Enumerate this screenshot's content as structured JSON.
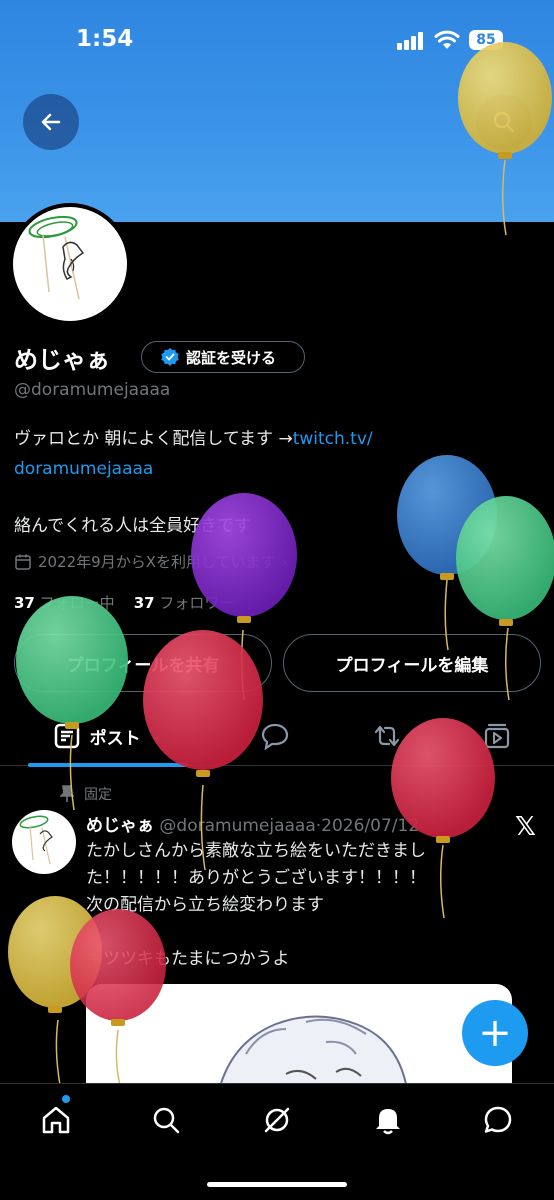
{
  "status_bar": {
    "time": "1:54",
    "battery": "85"
  },
  "profile": {
    "name": "めじゃぁ",
    "verify_label": "認証を受ける",
    "handle": "@doramumejaaaa",
    "bio_text": "ヴァロとか 朝によく配信してます →",
    "bio_link_part1": "twitch.tv/",
    "bio_link_part2": "doramumejaaaa",
    "bio_line2": "絡んでくれる人は全員好きです",
    "joined": "2022年9月からXを利用しています",
    "following_count": "37",
    "following_label": "フォロー中",
    "followers_count": "37",
    "followers_label": "フォロワー"
  },
  "buttons": {
    "share_profile": "プロフィールを共有",
    "edit_profile": "プロフィールを編集"
  },
  "tabs": {
    "posts": "ポスト"
  },
  "pinned_post": {
    "pinned_label": "固定",
    "author": "めじゃぁ",
    "handle_date": "@doramumejaaaa·2026/07/12",
    "text": "たかしさんから素敵な立ち絵をいただきました！！！！！ありがとうございます！！！！\n次の配信から立ち絵変わります\n\nキツツキもたまにつかうよ"
  },
  "icons": {
    "back": "back-arrow-icon",
    "search": "search-icon",
    "verified": "verified-badge-icon",
    "calendar": "calendar-icon",
    "chevron": "chevron-right-icon",
    "pin": "pin-icon",
    "x_logo": "x-logo-icon",
    "compose": "plus-icon",
    "home": "home-icon",
    "explore": "search-icon",
    "grok": "grok-icon",
    "notifications": "bell-icon",
    "messages": "chat-icon"
  },
  "colors": {
    "accent": "#1d9bf0",
    "banner": "#3a93e8",
    "background": "#000000"
  }
}
